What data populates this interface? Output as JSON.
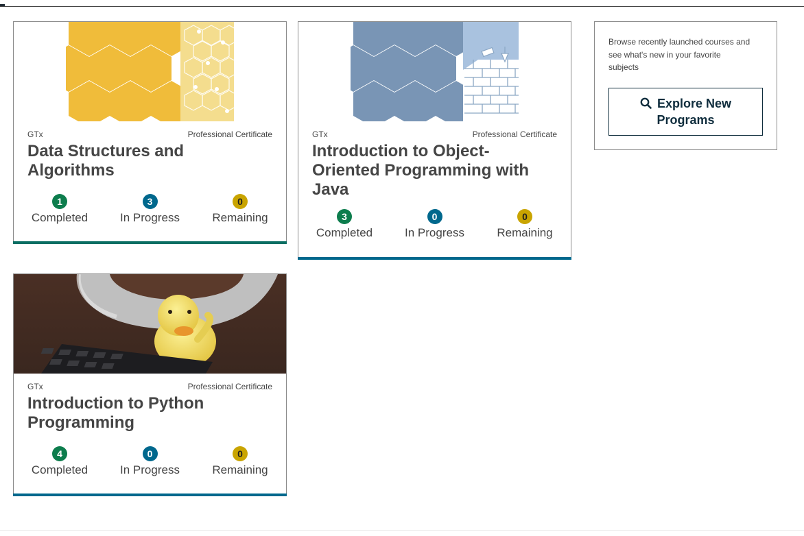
{
  "colors": {
    "completed": "#0d7d4d",
    "in_progress": "#00688d",
    "remaining": "#c9a400",
    "card_bar": "#0a6e73",
    "card_bar_blue": "#00688d",
    "brand_dark": "#0f2d3d"
  },
  "programs": [
    {
      "org": "GTx",
      "type": "Professional Certificate",
      "title": "Data Structures and Algorithms",
      "image_icon": "yellow-hexagon-pattern",
      "completed": {
        "count": "1",
        "label": "Completed"
      },
      "in_progress": {
        "count": "3",
        "label": "In Progress"
      },
      "remaining": {
        "count": "0",
        "label": "Remaining"
      }
    },
    {
      "org": "GTx",
      "type": "Professional Certificate",
      "title": "Introduction to Object-Oriented Programming with Java",
      "image_icon": "blue-hexagon-brick-wall",
      "completed": {
        "count": "3",
        "label": "Completed"
      },
      "in_progress": {
        "count": "0",
        "label": "In Progress"
      },
      "remaining": {
        "count": "0",
        "label": "Remaining"
      }
    },
    {
      "org": "GTx",
      "type": "Professional Certificate",
      "title": "Introduction to Python Programming",
      "image_icon": "rubber-duck-photo",
      "completed": {
        "count": "4",
        "label": "Completed"
      },
      "in_progress": {
        "count": "0",
        "label": "In Progress"
      },
      "remaining": {
        "count": "0",
        "label": "Remaining"
      }
    }
  ],
  "explore": {
    "description": "Browse recently launched courses and see what's new in your favorite subjects",
    "button_label": "Explore New Programs",
    "button_icon": "search-icon"
  }
}
